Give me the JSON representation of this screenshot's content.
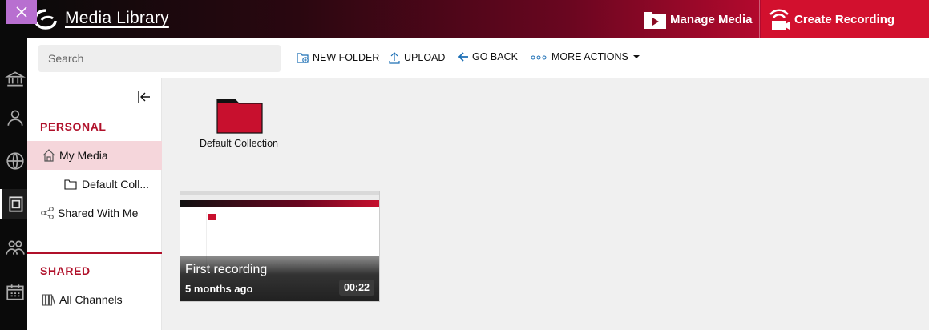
{
  "header": {
    "title": "Media Library",
    "manage_media": "Manage Media",
    "create_recording": "Create Recording"
  },
  "toolbar": {
    "search_placeholder": "Search",
    "new_folder": "NEW FOLDER",
    "upload": "UPLOAD",
    "go_back": "GO BACK",
    "more_actions": "MORE ACTIONS"
  },
  "sidebar": {
    "personal_title": "PERSONAL",
    "my_media": "My Media",
    "default_collection": "Default Coll...",
    "shared_with_me": "Shared With Me",
    "shared_title": "SHARED",
    "all_channels": "All Channels"
  },
  "content": {
    "folders": [
      {
        "label": "Default Collection"
      }
    ],
    "media": [
      {
        "title": "First recording",
        "age": "5 months ago",
        "duration": "00:22"
      }
    ]
  },
  "colors": {
    "accent": "#c8102e",
    "section_title": "#b0102a",
    "selected_bg": "#f5d6db",
    "rail_bg": "#0a0a0a",
    "close_tab": "#b86fd0"
  },
  "icons": {
    "rail": [
      "bank-icon",
      "user-icon",
      "globe-icon",
      "media-library-icon",
      "group-icon",
      "calendar-icon"
    ],
    "close": "close-icon",
    "logo": "logo-icon"
  }
}
